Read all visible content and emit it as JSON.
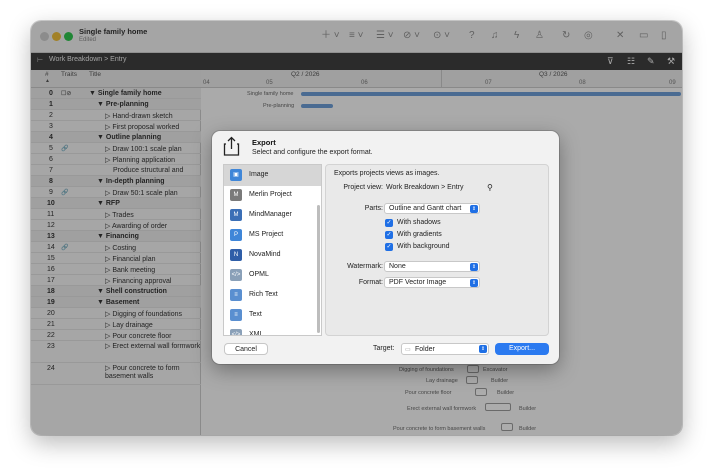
{
  "window": {
    "title": "Single family home",
    "subtitle": "Edited",
    "toolbar_icons": [
      "plus-icon",
      "list-icon",
      "outline-icon",
      "link-icon",
      "ellipsis-icon",
      "question-icon",
      "bell-icon",
      "bolt-icon",
      "person-icon",
      "sync-icon",
      "globe-icon",
      "tools-icon",
      "panel-bottom-icon",
      "panel-right-icon"
    ]
  },
  "breadcrumb": {
    "text": "Work Breakdown > Entry"
  },
  "outline": {
    "headers": {
      "num": "#",
      "traits": "Traits",
      "title": "Title"
    },
    "rows": [
      {
        "n": "0",
        "title": "▼ Single family home",
        "indent": 0,
        "bold": true,
        "traits": "☐⊘"
      },
      {
        "n": "1",
        "title": "▼ Pre-planning",
        "indent": 1,
        "bold": true,
        "traits": ""
      },
      {
        "n": "2",
        "title": "▷ Hand-drawn sketch",
        "indent": 2,
        "bold": false,
        "traits": ""
      },
      {
        "n": "3",
        "title": "▷ First proposal worked",
        "indent": 2,
        "bold": false,
        "traits": ""
      },
      {
        "n": "4",
        "title": "▼ Outline planning",
        "indent": 1,
        "bold": true,
        "traits": ""
      },
      {
        "n": "5",
        "title": "▷ Draw 100:1 scale plan",
        "indent": 2,
        "bold": false,
        "traits": "🔗"
      },
      {
        "n": "6",
        "title": "▷ Planning application",
        "indent": 2,
        "bold": false,
        "traits": ""
      },
      {
        "n": "7",
        "title": "Produce structural and",
        "indent": 3,
        "bold": false,
        "traits": ""
      },
      {
        "n": "8",
        "title": "▼ In-depth planning",
        "indent": 1,
        "bold": true,
        "traits": ""
      },
      {
        "n": "9",
        "title": "▷ Draw 50:1 scale plan",
        "indent": 2,
        "bold": false,
        "traits": "🔗"
      },
      {
        "n": "10",
        "title": "▼ RFP",
        "indent": 1,
        "bold": true,
        "traits": ""
      },
      {
        "n": "11",
        "title": "▷ Trades",
        "indent": 2,
        "bold": false,
        "traits": ""
      },
      {
        "n": "12",
        "title": "▷ Awarding of order",
        "indent": 2,
        "bold": false,
        "traits": ""
      },
      {
        "n": "13",
        "title": "▼ Financing",
        "indent": 1,
        "bold": true,
        "traits": ""
      },
      {
        "n": "14",
        "title": "▷ Costing",
        "indent": 2,
        "bold": false,
        "traits": "🔗"
      },
      {
        "n": "15",
        "title": "▷ Financial plan",
        "indent": 2,
        "bold": false,
        "traits": ""
      },
      {
        "n": "16",
        "title": "▷ Bank meeting",
        "indent": 2,
        "bold": false,
        "traits": ""
      },
      {
        "n": "17",
        "title": "▷ Financing approval",
        "indent": 2,
        "bold": false,
        "traits": ""
      },
      {
        "n": "18",
        "title": "▼ Shell construction",
        "indent": 1,
        "bold": true,
        "traits": ""
      },
      {
        "n": "19",
        "title": "▼ Basement",
        "indent": 1,
        "bold": true,
        "traits": ""
      },
      {
        "n": "20",
        "title": "▷ Digging of foundations",
        "indent": 2,
        "bold": false,
        "traits": ""
      },
      {
        "n": "21",
        "title": "▷ Lay drainage",
        "indent": 2,
        "bold": false,
        "traits": ""
      },
      {
        "n": "22",
        "title": "▷ Pour concrete floor",
        "indent": 2,
        "bold": false,
        "traits": ""
      },
      {
        "n": "23",
        "title": "▷ Erect external wall formwork",
        "indent": 2,
        "bold": false,
        "traits": ""
      },
      {
        "n": "24",
        "title": "▷ Pour concrete to form basement walls",
        "indent": 2,
        "bold": false,
        "traits": ""
      }
    ]
  },
  "gantt": {
    "quarters": [
      "Q2 / 2026",
      "Q3 / 2026"
    ],
    "months": [
      "04",
      "05",
      "06",
      "07",
      "08",
      "09"
    ],
    "top_labels": [
      "Single family home",
      "Pre-planning"
    ],
    "bottom_labels": [
      {
        "task": "Digging of foundations",
        "resource": "Excavator"
      },
      {
        "task": "Lay drainage",
        "resource": "Builder"
      },
      {
        "task": "Pour concrete floor",
        "resource": "Builder"
      },
      {
        "task": "Erect external wall formwork",
        "resource": "Builder"
      },
      {
        "task": "Pour concrete to form basement walls",
        "resource": "Builder"
      }
    ]
  },
  "dialog": {
    "title": "Export",
    "subtitle": "Select and configure the export format.",
    "formats": [
      {
        "label": "Image",
        "color": "#3f86d8",
        "glyph": "▣",
        "selected": true
      },
      {
        "label": "Merlin Project",
        "color": "#7a7a7a",
        "glyph": "M",
        "selected": false
      },
      {
        "label": "MindManager",
        "color": "#3b6fb6",
        "glyph": "M",
        "selected": false
      },
      {
        "label": "MS Project",
        "color": "#3f86d8",
        "glyph": "P",
        "selected": false
      },
      {
        "label": "NovaMind",
        "color": "#2f5ea8",
        "glyph": "N",
        "selected": false
      },
      {
        "label": "OPML",
        "color": "#8aa0b8",
        "glyph": "</>",
        "selected": false
      },
      {
        "label": "Rich Text",
        "color": "#5a8fd0",
        "glyph": "≡",
        "selected": false
      },
      {
        "label": "Text",
        "color": "#5a8fd0",
        "glyph": "≡",
        "selected": false
      },
      {
        "label": "XML",
        "color": "#8aa0b8",
        "glyph": "</>",
        "selected": false
      }
    ],
    "description": "Exports projects views as images.",
    "project_view_label": "Project view:",
    "project_view_value": "Work Breakdown > Entry",
    "parts_label": "Parts:",
    "parts_value": "Outline and Gantt chart",
    "options": [
      "With shadows",
      "With gradients",
      "With background"
    ],
    "watermark_label": "Watermark:",
    "watermark_value": "None",
    "format_label": "Format:",
    "format_value": "PDF Vector Image",
    "cancel_label": "Cancel",
    "target_label": "Target:",
    "target_value": "Folder",
    "export_label": "Export..."
  }
}
